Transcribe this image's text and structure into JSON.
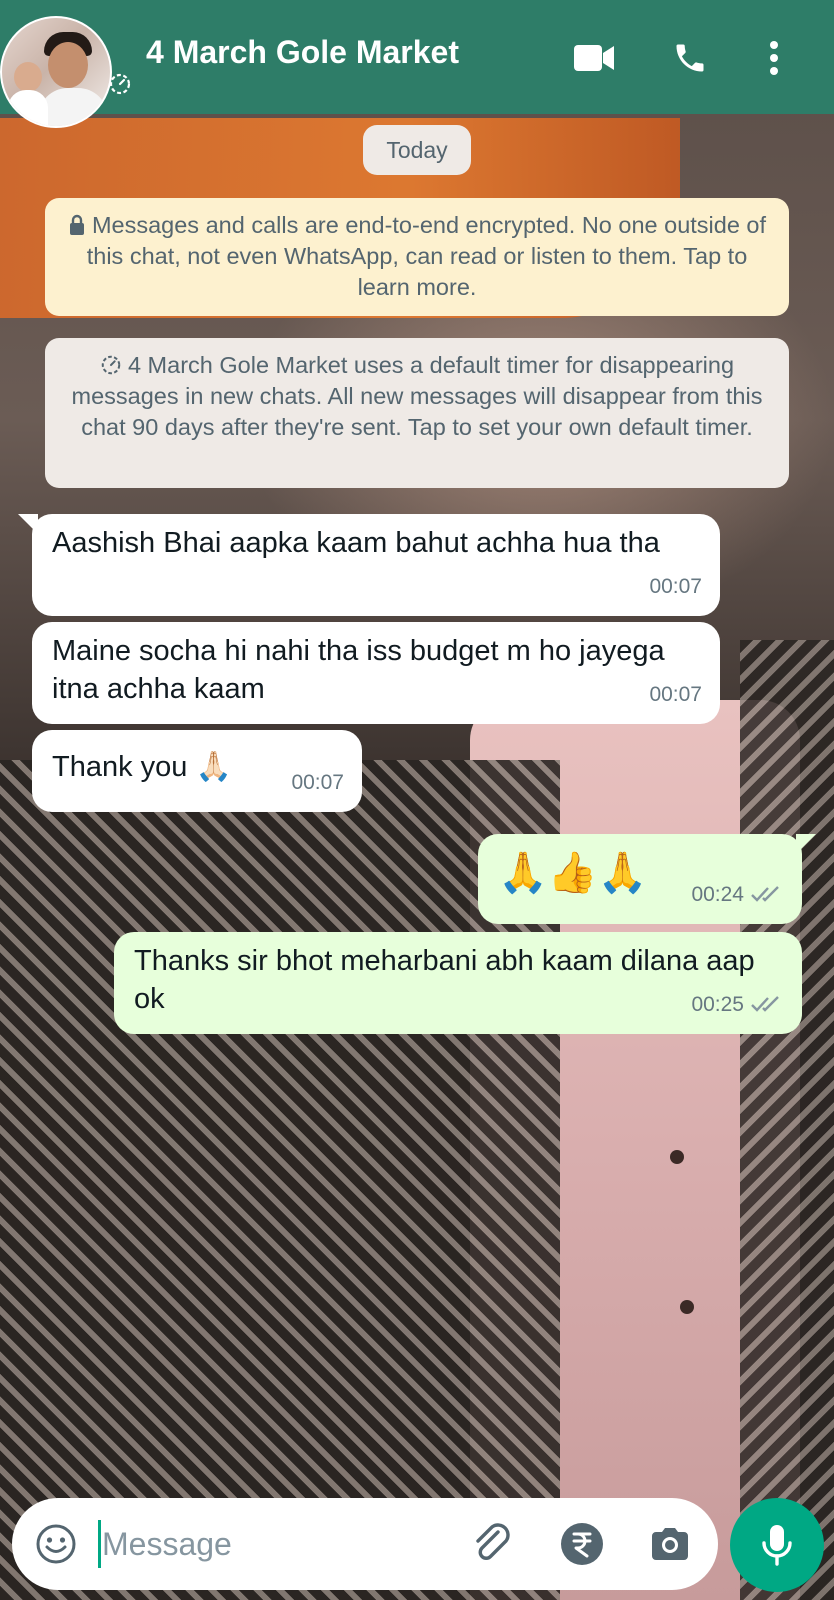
{
  "header": {
    "contact_name": "4 March Gole Market",
    "icons": [
      "video-call-icon",
      "voice-call-icon",
      "more-options-icon"
    ]
  },
  "chat": {
    "date_chip": "Today",
    "encryption_notice": "Messages and calls are end-to-end encrypted. No one outside of this chat, not even WhatsApp, can read or listen to them. Tap to learn more.",
    "timer_notice": "4 March Gole Market uses a default timer for disappearing messages in new chats. All new messages will disappear from this chat 90 days after they're sent. Tap to set your own default timer.",
    "messages": [
      {
        "direction": "incoming",
        "text": "Aashish Bhai aapka kaam bahut achha hua tha",
        "time": "00:07"
      },
      {
        "direction": "incoming",
        "text": "Maine socha hi nahi tha iss budget m ho jayega itna achha kaam",
        "time": "00:07"
      },
      {
        "direction": "incoming",
        "text": "Thank you 🙏🏻",
        "time": "00:07"
      },
      {
        "direction": "outgoing",
        "text": "🙏👍🙏",
        "time": "00:24",
        "status": "delivered"
      },
      {
        "direction": "outgoing",
        "text": "Thanks sir bhot meharbani abh kaam dilana aap ok",
        "time": "00:25",
        "status": "delivered"
      }
    ]
  },
  "composer": {
    "placeholder": "Message",
    "icons": [
      "emoji-icon",
      "attach-icon",
      "rupee-icon",
      "camera-icon",
      "mic-icon"
    ]
  },
  "colors": {
    "header": "#2e7d68",
    "incoming_bubble": "#ffffff",
    "outgoing_bubble": "#e7ffdb",
    "accent": "#00a884",
    "encryption_bg": "#fdf1cf"
  }
}
